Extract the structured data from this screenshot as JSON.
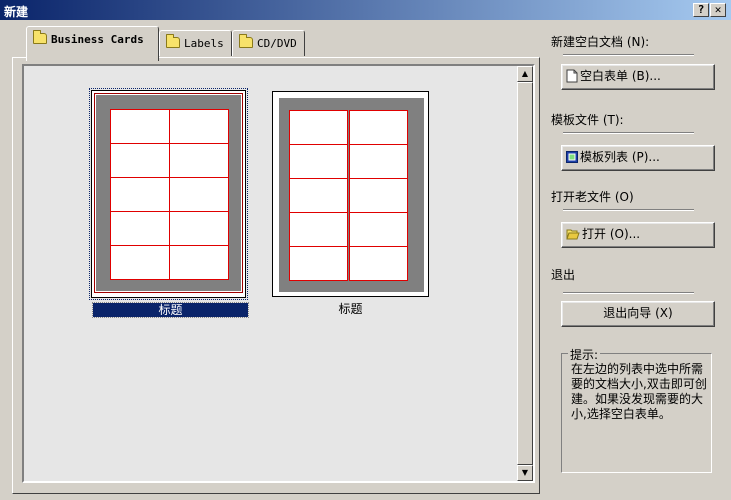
{
  "window": {
    "title": "新建",
    "help_label": "?",
    "close_label": "✕"
  },
  "tabs": [
    {
      "label": "Business Cards",
      "active": true
    },
    {
      "label": "Labels",
      "active": false
    },
    {
      "label": "CD/DVD",
      "active": false
    }
  ],
  "templates": [
    {
      "caption": "标题",
      "selected": true
    },
    {
      "caption": "标题",
      "selected": false
    }
  ],
  "right": {
    "new_blank": {
      "label": "新建空白文档 (N):",
      "button": "空白表单 (B)...",
      "icon": "document-icon"
    },
    "template": {
      "label": "模板文件 (T):",
      "button": "模板列表 (P)...",
      "icon": "template-list-icon"
    },
    "open_old": {
      "label": "打开老文件 (O)",
      "button": "打开 (O)...",
      "icon": "open-folder-icon"
    },
    "exit": {
      "label": "退出",
      "button": "退出向导 (X)"
    }
  },
  "hint": {
    "title": "提示:",
    "text": "在左边的列表中选中所需要的文档大小,双击即可创建。如果没发现需要的大小,选择空白表单。"
  },
  "scrollbar": {
    "up_icon": "scroll-up-icon",
    "down_icon": "scroll-down-icon"
  }
}
